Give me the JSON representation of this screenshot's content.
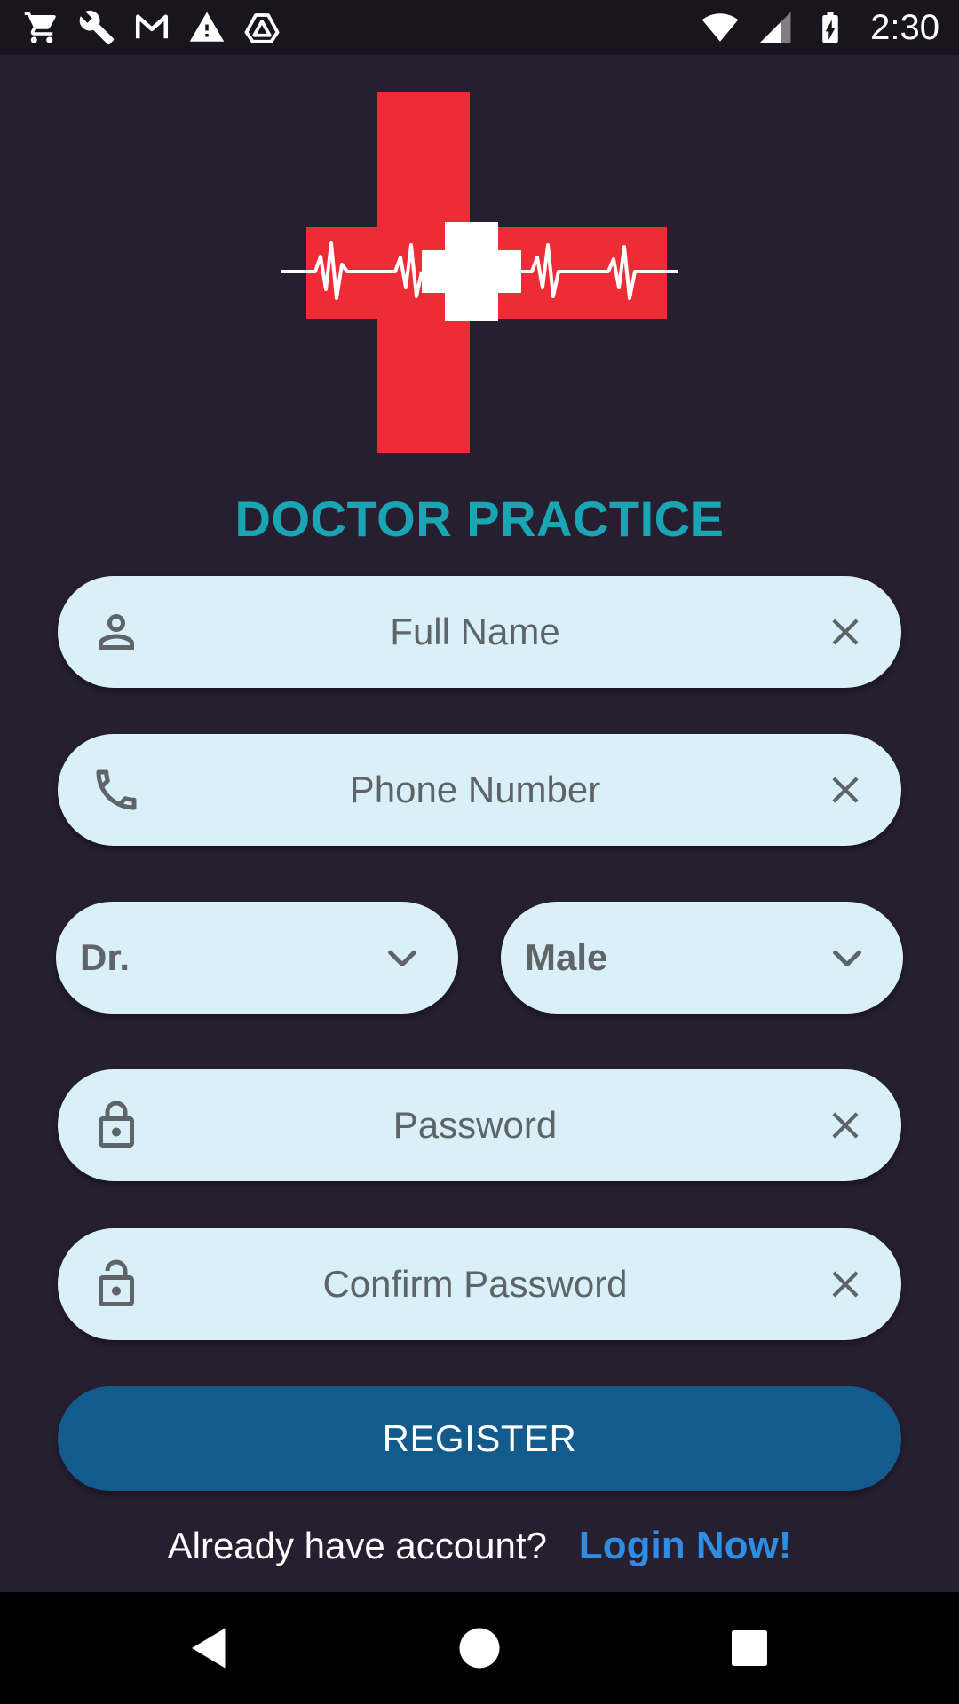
{
  "status_bar": {
    "time": "2:30",
    "left_icons": [
      "cart-icon",
      "wrench-icon",
      "gmail-icon",
      "warning-icon",
      "drive-icon"
    ],
    "right_icons": [
      "wifi-icon",
      "cell-signal-icon",
      "battery-charging-icon"
    ]
  },
  "app": {
    "title": "DOCTOR PRACTICE"
  },
  "form": {
    "full_name": {
      "placeholder": "Full Name",
      "icon": "person-icon"
    },
    "phone": {
      "placeholder": "Phone Number",
      "icon": "phone-icon"
    },
    "title_select": {
      "value": "Dr."
    },
    "gender_select": {
      "value": "Male"
    },
    "password": {
      "placeholder": "Password",
      "icon": "lock-icon"
    },
    "confirm_password": {
      "placeholder": "Confirm Password",
      "icon": "lock-open-icon"
    },
    "register_label": "REGISTER",
    "login_prompt": "Already have account?",
    "login_link": "Login Now!"
  },
  "colors": {
    "background": "#261F2F",
    "title": "#1AA5B4",
    "field_bg": "#D9F0F9",
    "button": "#135B8D",
    "link": "#2F8DE4",
    "cross_red": "#EE2C36"
  }
}
